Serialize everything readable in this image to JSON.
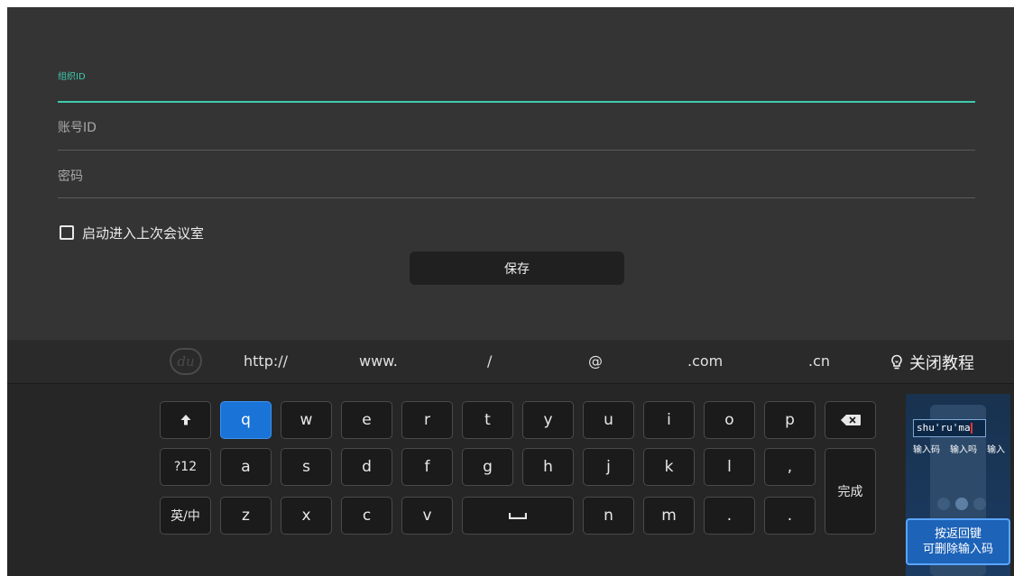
{
  "form": {
    "org_id_label": "组织ID",
    "org_id_value": "",
    "account_id_label": "账号ID",
    "password_label": "密码",
    "remember_label": "启动进入上次会议室",
    "remember_checked": false,
    "save_label": "保存",
    "accent_color": "#3fcbb0"
  },
  "keyboard": {
    "logo_icon": "du-logo",
    "quick_inputs": [
      "http://",
      "www.",
      "/",
      "@",
      ".com",
      ".cn"
    ],
    "close_tutorial_label": "关闭教程",
    "close_tutorial_icon": "lightbulb-icon",
    "rows": [
      [
        "q",
        "w",
        "e",
        "r",
        "t",
        "y",
        "u",
        "i",
        "o",
        "p"
      ],
      [
        "a",
        "s",
        "d",
        "f",
        "g",
        "h",
        "j",
        "k",
        "l",
        ","
      ],
      [
        "z",
        "x",
        "c",
        "v",
        "n",
        "m",
        "."
      ]
    ],
    "shift_icon": "arrow-up-icon",
    "backspace_icon": "backspace-icon",
    "space_icon": "space-bar-icon",
    "numeric_label": "?12",
    "lang_label_main": "英/",
    "lang_label_sub": "中",
    "done_label": "完成",
    "active_key": "q",
    "active_color": "#1a73d6"
  },
  "tutorial": {
    "input_text": "shu'ru'ma",
    "candidates": [
      "输入码",
      "输入吗",
      "输入"
    ],
    "hint_line1": "按返回键",
    "hint_line2": "可删除输入码"
  }
}
